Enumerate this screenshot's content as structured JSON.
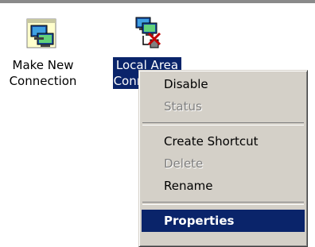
{
  "desktop": {
    "icons": [
      {
        "label_line1": "Make New",
        "label_line2": "Connection",
        "icon": "make-new-connection-icon",
        "selected": false
      },
      {
        "label_line1": "Local Area",
        "label_line2": "Connection",
        "icon": "local-area-connection-disconnected-icon",
        "selected": true
      }
    ]
  },
  "context_menu": {
    "items": [
      {
        "label": "Disable",
        "enabled": true
      },
      {
        "label": "Status",
        "enabled": false
      },
      {
        "label": "Create Shortcut",
        "enabled": true
      },
      {
        "label": "Delete",
        "enabled": false
      },
      {
        "label": "Rename",
        "enabled": true
      },
      {
        "label": "Properties",
        "enabled": true,
        "bold": true,
        "highlighted": true
      }
    ]
  },
  "colors": {
    "selection": "#0a246a",
    "menu_bg": "#d4d0c8",
    "disabled_text": "#808080"
  }
}
